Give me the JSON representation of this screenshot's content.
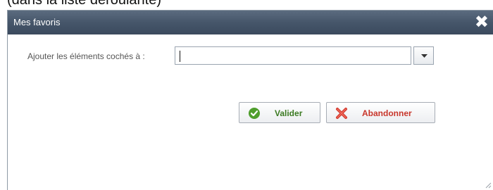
{
  "caption": "(dans la liste déroulante)",
  "dialog": {
    "title": "Mes favoris",
    "close_symbol": "✖"
  },
  "form": {
    "label": "Ajouter les éléments cochés à :",
    "input_value": "",
    "dropdown_icon": "chevron-down-icon"
  },
  "buttons": {
    "validate_label": "Valider",
    "cancel_label": "Abandonner"
  },
  "colors": {
    "titlebar": "#46566a",
    "validate_text": "#3b7a22",
    "cancel_text": "#c8362b"
  }
}
